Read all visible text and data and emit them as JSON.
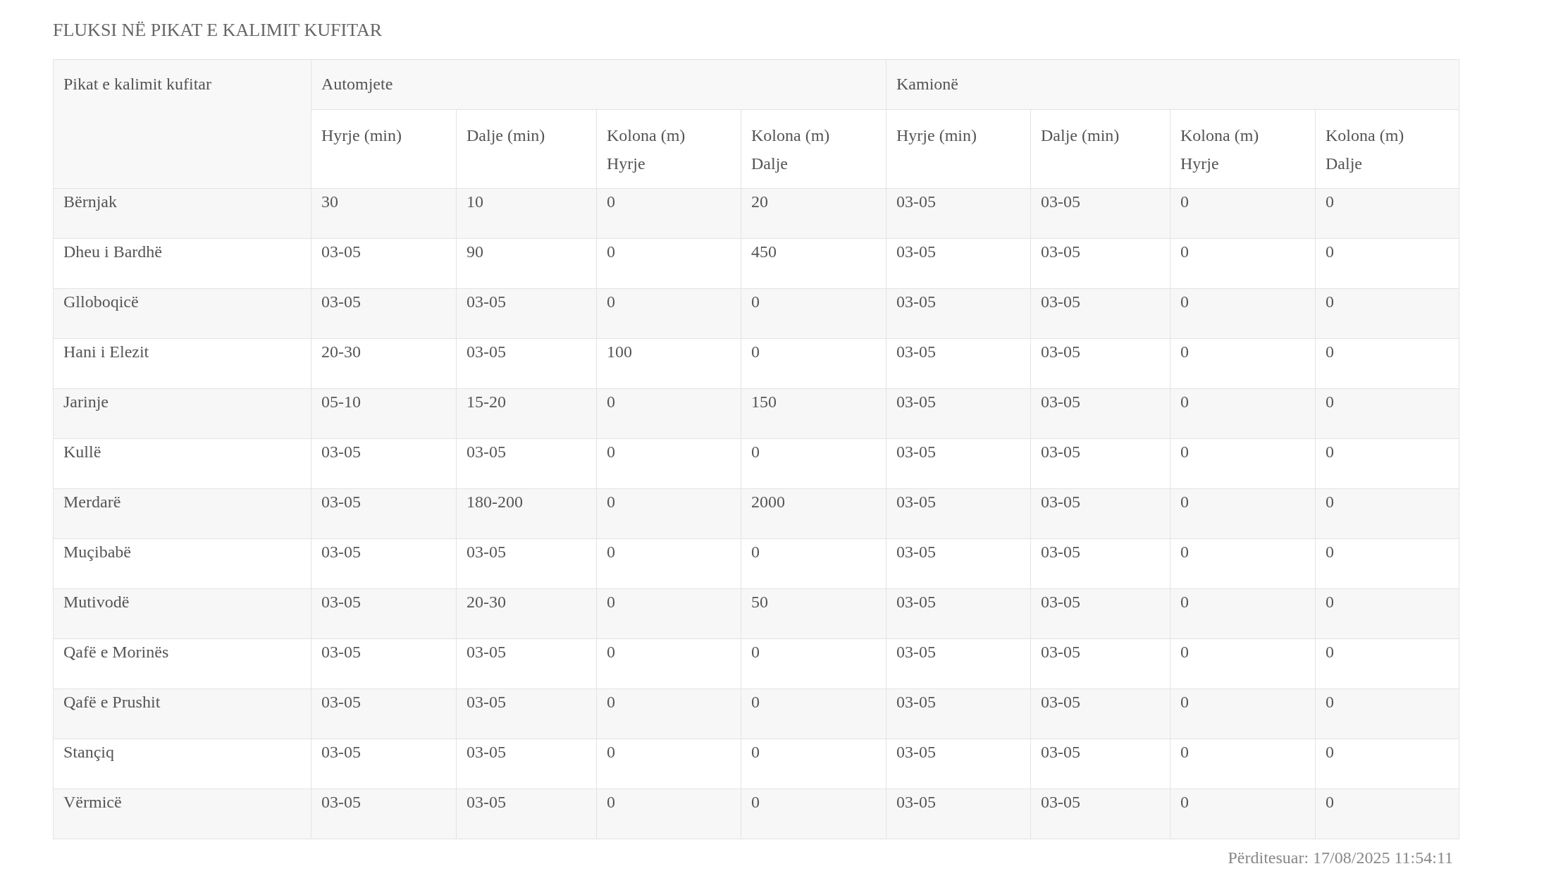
{
  "title": "FLUKSI NË PIKAT E KALIMIT KUFITAR",
  "table": {
    "first_column": "Pikat e kalimit kufitar",
    "groups": [
      {
        "label": "Automjete",
        "columns": [
          "Hyrje (min)",
          "Dalje (min)",
          "Kolona (m) Hyrje",
          "Kolona (m) Dalje"
        ]
      },
      {
        "label": "Kamionë",
        "columns": [
          "Hyrje (min)",
          "Dalje (min)",
          "Kolona (m) Hyrje",
          "Kolona (m) Dalje"
        ]
      }
    ],
    "rows": [
      [
        "Bërnjak",
        "30",
        "10",
        "0",
        "20",
        "03-05",
        "03-05",
        "0",
        "0"
      ],
      [
        "Dheu i Bardhë",
        "03-05",
        "90",
        "0",
        "450",
        "03-05",
        "03-05",
        "0",
        "0"
      ],
      [
        "Glloboqicë",
        "03-05",
        "03-05",
        "0",
        "0",
        "03-05",
        "03-05",
        "0",
        "0"
      ],
      [
        "Hani i Elezit",
        "20-30",
        "03-05",
        "100",
        "0",
        "03-05",
        "03-05",
        "0",
        "0"
      ],
      [
        "Jarinje",
        "05-10",
        "15-20",
        "0",
        "150",
        "03-05",
        "03-05",
        "0",
        "0"
      ],
      [
        "Kullë",
        "03-05",
        "03-05",
        "0",
        "0",
        "03-05",
        "03-05",
        "0",
        "0"
      ],
      [
        "Merdarë",
        "03-05",
        "180-200",
        "0",
        "2000",
        "03-05",
        "03-05",
        "0",
        "0"
      ],
      [
        "Muçibabë",
        "03-05",
        "03-05",
        "0",
        "0",
        "03-05",
        "03-05",
        "0",
        "0"
      ],
      [
        "Mutivodë",
        "03-05",
        "20-30",
        "0",
        "50",
        "03-05",
        "03-05",
        "0",
        "0"
      ],
      [
        "Qafë e Morinës",
        "03-05",
        "03-05",
        "0",
        "0",
        "03-05",
        "03-05",
        "0",
        "0"
      ],
      [
        "Qafë e Prushit",
        "03-05",
        "03-05",
        "0",
        "0",
        "03-05",
        "03-05",
        "0",
        "0"
      ],
      [
        "Stançiq",
        "03-05",
        "03-05",
        "0",
        "0",
        "03-05",
        "03-05",
        "0",
        "0"
      ],
      [
        "Vërmicë",
        "03-05",
        "03-05",
        "0",
        "0",
        "03-05",
        "03-05",
        "0",
        "0"
      ]
    ]
  },
  "updated": "Përditesuar: 17/08/2025 11:54:11"
}
